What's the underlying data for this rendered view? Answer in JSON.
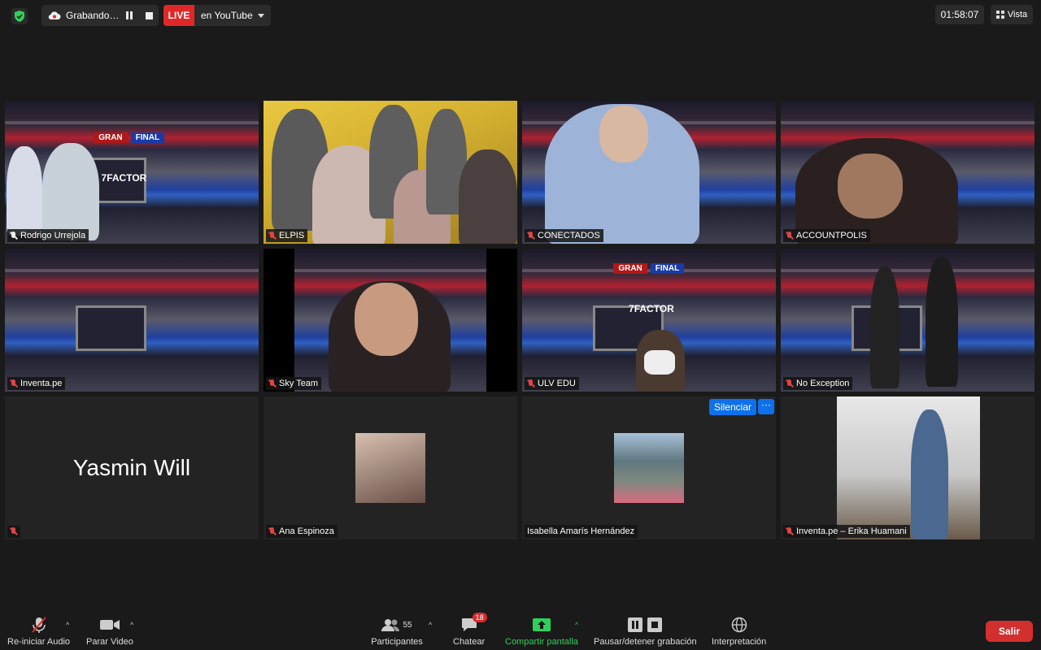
{
  "topbar": {
    "recording_label": "Grabando…",
    "live_badge": "LIVE",
    "live_destination": "en YouTube",
    "timer": "01:58:07",
    "view_label": "Vista"
  },
  "tiles": [
    {
      "name": "Rodrigo Urrejola",
      "banner_gran": "GRAN",
      "banner_final": "FINAL",
      "logo": "7FACTOR"
    },
    {
      "name": "ELPIS"
    },
    {
      "name": "CONECTADOS"
    },
    {
      "name": "ACCOUNTPOLIS"
    },
    {
      "name": "Inventa.pe"
    },
    {
      "name": "Sky Team"
    },
    {
      "name": "ULV EDU",
      "banner_gran": "GRAN",
      "banner_final": "FINAL",
      "logo": "7FACTOR"
    },
    {
      "name": "No Exception"
    },
    {
      "name": "",
      "display_name": "Yasmin Will"
    },
    {
      "name": "Ana Espinoza"
    },
    {
      "name": "Isabella Amarís Hernández",
      "mute_button": "Silenciar",
      "more_button": "···"
    },
    {
      "name": "Inventa.pe – Erika Huamani"
    }
  ],
  "toolbar": {
    "audio": "Re-iniciar Audio",
    "video": "Parar Video",
    "participants": "Participantes",
    "participants_count": "55",
    "chat": "Chatear",
    "chat_badge": "18",
    "share": "Compartir pantalla",
    "record": "Pausar/detener grabación",
    "interpretation": "Interpretación",
    "leave": "Salir"
  },
  "colors": {
    "live_red": "#e02828",
    "share_green": "#2fd05a",
    "speaker_highlight": "#e8f06e",
    "zoom_blue": "#0e71eb"
  }
}
